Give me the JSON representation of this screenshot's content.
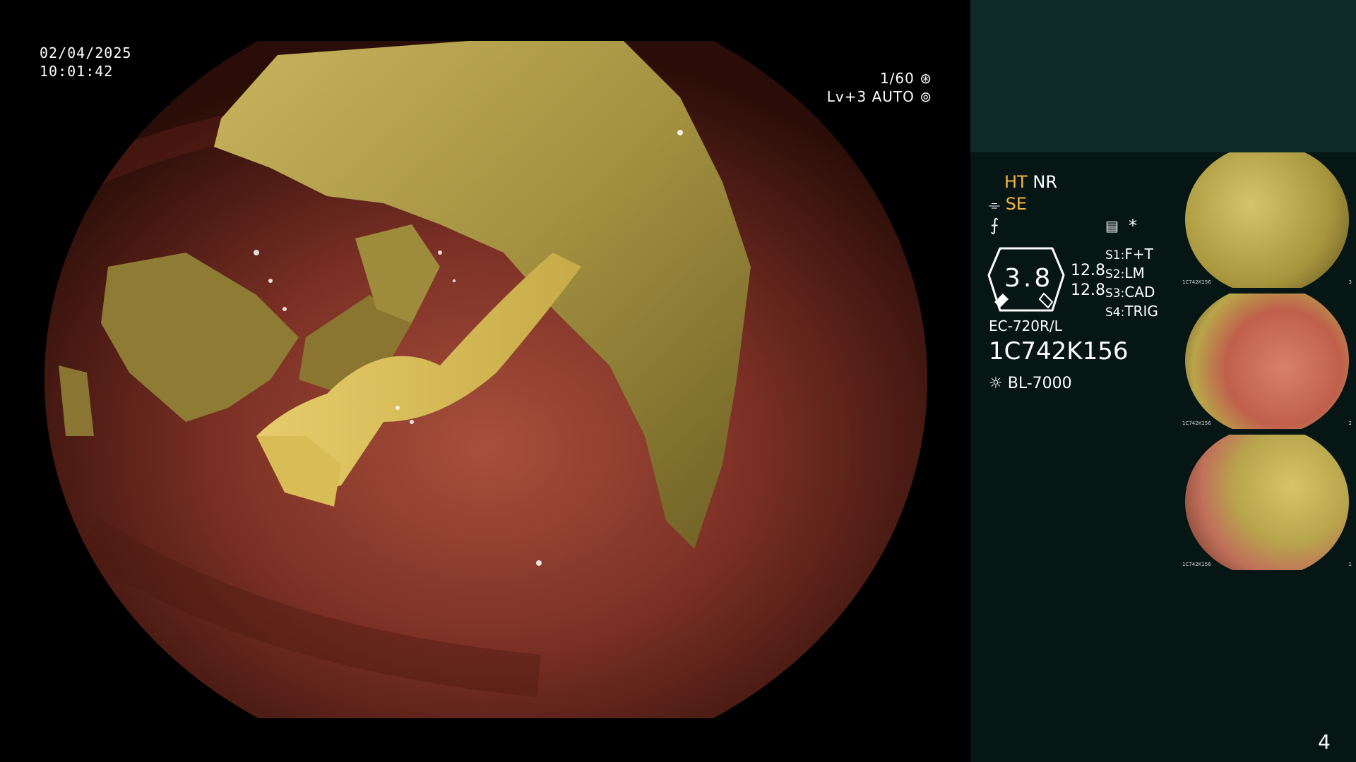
{
  "overlay": {
    "date": "02/04/2025",
    "time": "10:01:42",
    "shutter": "1/60",
    "level": "Lv+3 AUTO"
  },
  "panel": {
    "ht": "HT",
    "nr": "NR",
    "se": "SE",
    "gauge_value": "3.8",
    "pressure_top": "12.8",
    "pressure_bottom": "12.8",
    "switches": [
      {
        "key": "S1",
        "value": "F+T"
      },
      {
        "key": "S2",
        "value": "LM"
      },
      {
        "key": "S3",
        "value": "CAD"
      },
      {
        "key": "S4",
        "value": "TRIG"
      }
    ],
    "scope_model": "EC-720R/L",
    "serial": "1C742K156",
    "light_source": "BL-7000",
    "asterisk": "*"
  },
  "thumbnails": [
    {
      "label": "1C742K156",
      "index": "3"
    },
    {
      "label": "1C742K156",
      "index": "2"
    },
    {
      "label": "1C742K156",
      "index": "1"
    }
  ],
  "page_number": "4",
  "colors": {
    "panel_top": "#0d2a28",
    "panel": "#061614",
    "accent_yellow": "#f4b53a"
  },
  "icons": [
    "shutter-icon",
    "auto-iris-icon",
    "structure-enhance-icon",
    "color-tone-icon",
    "menu-icon",
    "light-source-icon"
  ]
}
